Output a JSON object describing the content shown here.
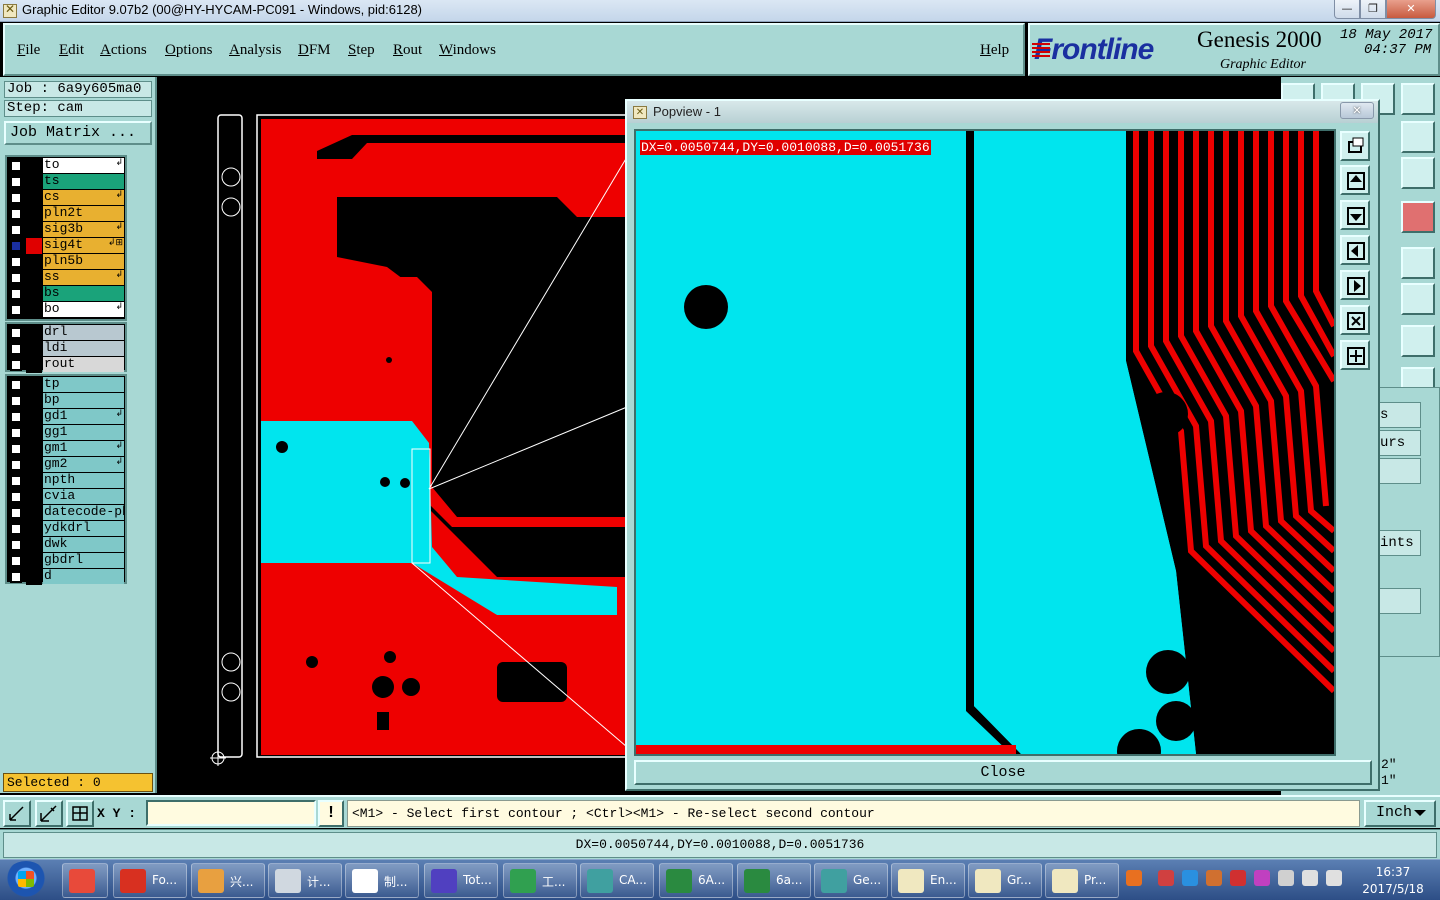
{
  "window": {
    "title": "Graphic Editor 9.07b2 (00@HY-HYCAM-PC091 - Windows, pid:6128)",
    "min_glyph": "—",
    "max_glyph": "❐",
    "close_glyph": "✕"
  },
  "menu": [
    "File",
    "Edit",
    "Actions",
    "Options",
    "Analysis",
    "DFM",
    "Step",
    "Rout",
    "Windows"
  ],
  "help_label": "Help",
  "brand": {
    "logo": "Frontline",
    "name": "Genesis 2000",
    "subtitle": "Graphic Editor",
    "date": "18 May 2017",
    "time": "04:37 PM"
  },
  "job": {
    "job_line": "Job : 6a9y605ma0",
    "step_line": "Step: cam",
    "matrix_button": "Job Matrix ..."
  },
  "layers_group1": [
    {
      "name": "to",
      "color": "#ffffff",
      "flag": "↲"
    },
    {
      "name": "ts",
      "color": "#1aa37a",
      "flag": ""
    },
    {
      "name": "cs",
      "color": "#e8b030",
      "flag": "↲"
    },
    {
      "name": "pln2t",
      "color": "#e8b030",
      "flag": ""
    },
    {
      "name": "sig3b",
      "color": "#e8b030",
      "flag": "↲"
    },
    {
      "name": "sig4t",
      "color": "#e8b030",
      "flag": "↲⊞",
      "checked": true
    },
    {
      "name": "pln5b",
      "color": "#e8b030",
      "flag": ""
    },
    {
      "name": "ss",
      "color": "#e8b030",
      "flag": "↲"
    },
    {
      "name": "bs",
      "color": "#1aa37a",
      "flag": ""
    },
    {
      "name": "bo",
      "color": "#ffffff",
      "flag": "↲"
    }
  ],
  "layers_group2": [
    {
      "name": "drl",
      "color": "#b8c8d0",
      "flag": ""
    },
    {
      "name": "ldi",
      "color": "#b8c8d0",
      "flag": ""
    },
    {
      "name": "rout",
      "color": "#d8d8d8",
      "flag": ""
    }
  ],
  "layers_group3": [
    {
      "name": "tp",
      "color": "#7fc8c8",
      "flag": ""
    },
    {
      "name": "bp",
      "color": "#7fc8c8",
      "flag": ""
    },
    {
      "name": "gd1",
      "color": "#7fc8c8",
      "flag": "↲"
    },
    {
      "name": "gg1",
      "color": "#7fc8c8",
      "flag": ""
    },
    {
      "name": "gm1",
      "color": "#7fc8c8",
      "flag": "↲"
    },
    {
      "name": "gm2",
      "color": "#7fc8c8",
      "flag": "↲"
    },
    {
      "name": "npth",
      "color": "#7fc8c8",
      "flag": ""
    },
    {
      "name": "cvia",
      "color": "#7fc8c8",
      "flag": ""
    },
    {
      "name": "datecode-pbe",
      "color": "#7fc8c8",
      "flag": ""
    },
    {
      "name": "ydkdrl",
      "color": "#7fc8c8",
      "flag": ""
    },
    {
      "name": "dwk",
      "color": "#7fc8c8",
      "flag": ""
    },
    {
      "name": "gbdrl",
      "color": "#7fc8c8",
      "flag": ""
    },
    {
      "name": "d",
      "color": "#7fc8c8",
      "flag": ""
    }
  ],
  "selected": "Selected : 0",
  "popview": {
    "title": "Popview - 1",
    "close_x": "✕",
    "readout": "DX=0.0050744,DY=0.0010088,D=0.0051736",
    "close_button": "Close"
  },
  "right_panel": {
    "partial_labels": [
      "s",
      "urs",
      "",
      "ints",
      ""
    ],
    "readout_a": "2\"",
    "readout_b": "1\""
  },
  "command": {
    "xy_label": "X Y :",
    "xy_value": "",
    "excl": "!",
    "prompt": "<M1> - Select first contour ; <Ctrl><M1> - Re-select second contour",
    "unit": "Inch"
  },
  "status_value": "DX=0.0050744,DY=0.0010088,D=0.0051736",
  "taskbar": {
    "tasks": [
      {
        "label": "",
        "color": "#e84a3a"
      },
      {
        "label": "Fo...",
        "color": "#d83020"
      },
      {
        "label": "兴...",
        "color": "#e8a040"
      },
      {
        "label": "计...",
        "color": "#d0d8e0"
      },
      {
        "label": "制...",
        "color": "#ffffff"
      },
      {
        "label": "Tot...",
        "color": "#5040c0"
      },
      {
        "label": "工...",
        "color": "#30a050"
      },
      {
        "label": "CA...",
        "color": "#40a0a0"
      },
      {
        "label": "6A...",
        "color": "#2a8a40"
      },
      {
        "label": "6a...",
        "color": "#2a8a40"
      },
      {
        "label": "Ge...",
        "color": "#40a0a0"
      },
      {
        "label": "En...",
        "color": "#f0e8c0"
      },
      {
        "label": "Gr...",
        "color": "#f0e8c0"
      },
      {
        "label": "Pr...",
        "color": "#f0e8c0"
      }
    ],
    "clock_time": "16:37",
    "clock_date": "2017/5/18"
  }
}
